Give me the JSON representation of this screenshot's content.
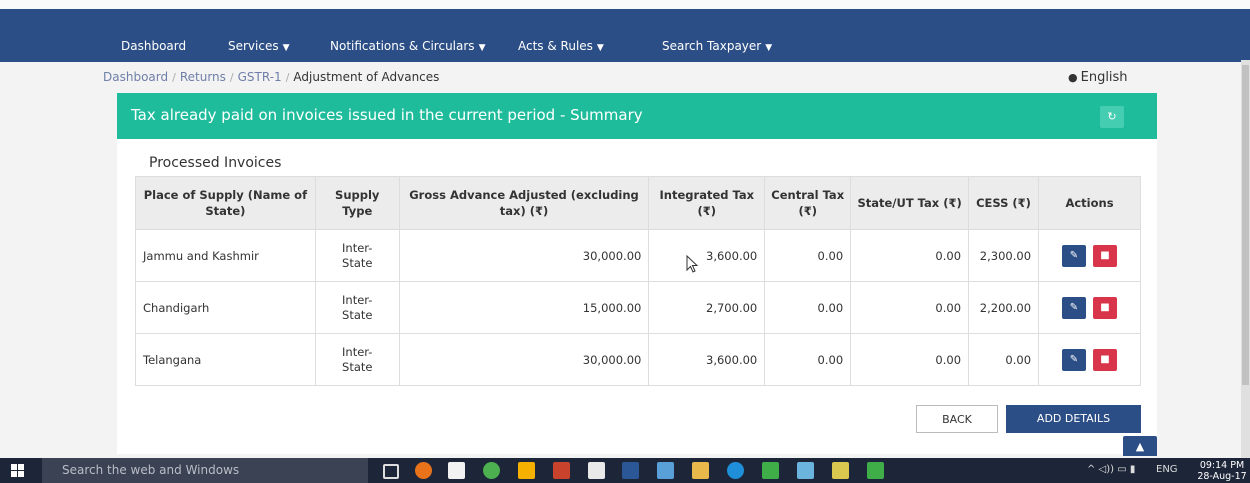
{
  "nav": {
    "items": [
      {
        "label": "Dashboard"
      },
      {
        "label": "Services"
      },
      {
        "label": "Notifications & Circulars"
      },
      {
        "label": "Acts & Rules"
      },
      {
        "label": "Search Taxpayer"
      }
    ]
  },
  "breadcrumb": {
    "items": [
      "Dashboard",
      "Returns",
      "GSTR-1"
    ],
    "current": "Adjustment of Advances"
  },
  "language": {
    "label": "English",
    "icon": "globe-icon"
  },
  "banner": {
    "title": "Tax already paid on invoices issued in the current period - Summary",
    "icon": "refresh-icon"
  },
  "section_title": "Processed Invoices",
  "table": {
    "headers": [
      "Place of Supply (Name of State)",
      "Supply Type",
      "Gross Advance Adjusted (excluding tax) (₹)",
      "Integrated Tax (₹)",
      "Central Tax (₹)",
      "State/UT Tax (₹)",
      "CESS (₹)",
      "Actions"
    ],
    "rows": [
      {
        "state": "Jammu and Kashmir",
        "supply_type_1": "Inter-",
        "supply_type_2": "State",
        "gross": "30,000.00",
        "igst": "3,600.00",
        "cgst": "0.00",
        "sgst": "0.00",
        "cess": "2,300.00"
      },
      {
        "state": "Chandigarh",
        "supply_type_1": "Inter-",
        "supply_type_2": "State",
        "gross": "15,000.00",
        "igst": "2,700.00",
        "cgst": "0.00",
        "sgst": "0.00",
        "cess": "2,200.00"
      },
      {
        "state": "Telangana",
        "supply_type_1": "Inter-",
        "supply_type_2": "State",
        "gross": "30,000.00",
        "igst": "3,600.00",
        "cgst": "0.00",
        "sgst": "0.00",
        "cess": "0.00"
      }
    ]
  },
  "buttons": {
    "back": "BACK",
    "add_details": "ADD DETAILS"
  },
  "taskbar": {
    "search_placeholder": "Search the web and Windows",
    "tray_lang": "ENG",
    "time": "09:14 PM",
    "date": "28-Aug-17"
  },
  "colors": {
    "navbar": "#2c4e86",
    "banner": "#1fbc9c",
    "delete": "#d8344a"
  }
}
